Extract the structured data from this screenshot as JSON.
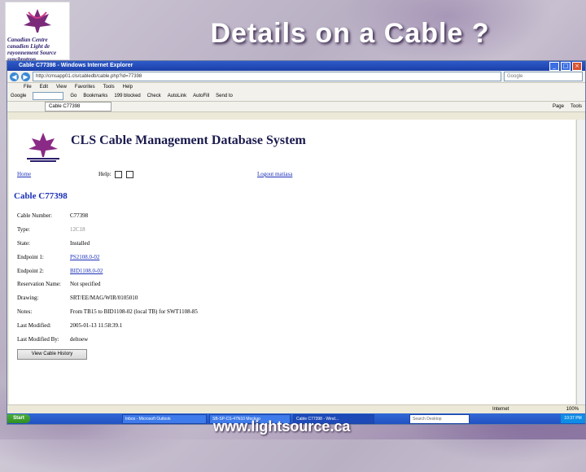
{
  "slide": {
    "title": "Details on a Cable ?",
    "footer_url": "www.lightsource.ca",
    "logo_text": "Canadian Centre canadien Light de rayonnement Source synchrotron"
  },
  "browser": {
    "window_title": "Cable C77398 - Windows Internet Explorer",
    "address": "http://cmsapp01.cls/cabledb/cable.php?id=77398",
    "search_placeholder": "Google",
    "menu": [
      "File",
      "Edit",
      "View",
      "Favorites",
      "Tools",
      "Help"
    ],
    "google_toolbar": [
      "Google",
      "Go",
      "Bookmarks",
      "199 blocked",
      "Check",
      "AutoLink",
      "AutoFill",
      "Send to"
    ],
    "tab_label": "Cable C77398",
    "tab_tools": [
      "Page",
      "Tools"
    ],
    "status_zone": "Internet",
    "status_zoom": "100%",
    "taskbar": {
      "start": "Start",
      "tasks": [
        "Inbox - Microsoft Outlook",
        "SB-SP-CS-47N10 Mockup",
        "Cable C77398 - Wind..."
      ],
      "search": "Search Desktop",
      "clock": "10:37 PM"
    }
  },
  "app": {
    "title": "CLS Cable Management Database System",
    "home_link": "Home",
    "help_label": "Help:",
    "logout_link": "Logout matiasa",
    "cable_heading": "Cable C77398",
    "fields": [
      {
        "label": "Cable Number:",
        "value": "C77398"
      },
      {
        "label": "Type:",
        "value": "12C18"
      },
      {
        "label": "State:",
        "value": "Installed"
      },
      {
        "label": "Endpoint 1:",
        "value": "PS2108.0-02"
      },
      {
        "label": "Endpoint 2:",
        "value": "BID1108.0-02"
      },
      {
        "label": "Reservation Name:",
        "value": "Not specified"
      },
      {
        "label": "Drawing:",
        "value": "SRT/EE/MAG/WIR/0105010"
      },
      {
        "label": "Notes:",
        "value": "From TB15 to BID1108-02 (local TB) for SWT1108-85"
      },
      {
        "label": "Last Modified:",
        "value": "2005-01-13 11:58:39.1"
      },
      {
        "label": "Last Modified By:",
        "value": "deltoew"
      }
    ],
    "history_button": "View Cable History"
  }
}
